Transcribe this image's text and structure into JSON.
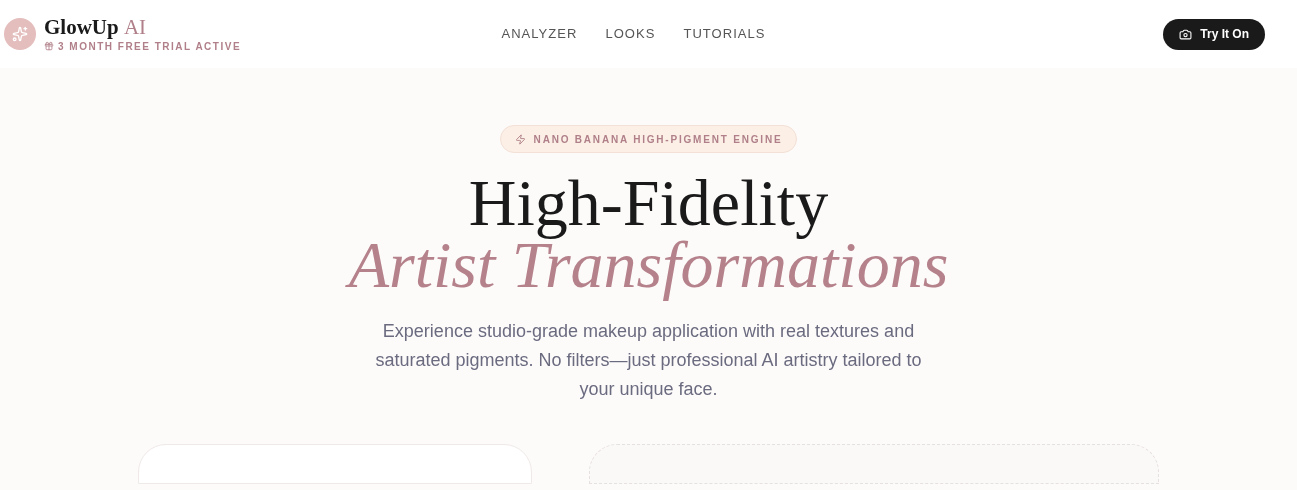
{
  "brand": {
    "name": "GlowUp",
    "accent": "AI",
    "trial": "3 MONTH FREE TRIAL ACTIVE"
  },
  "nav": [
    {
      "label": "ANALYZER"
    },
    {
      "label": "LOOKS"
    },
    {
      "label": "TUTORIALS"
    }
  ],
  "cta": {
    "label": "Try It On"
  },
  "hero": {
    "badge": "NANO BANANA HIGH-PIGMENT ENGINE",
    "title": "High-Fidelity",
    "title_accent": "Artist Transformations",
    "subtitle": "Experience studio-grade makeup application with real textures and saturated pigments. No filters—just professional AI artistry tailored to your unique face."
  }
}
